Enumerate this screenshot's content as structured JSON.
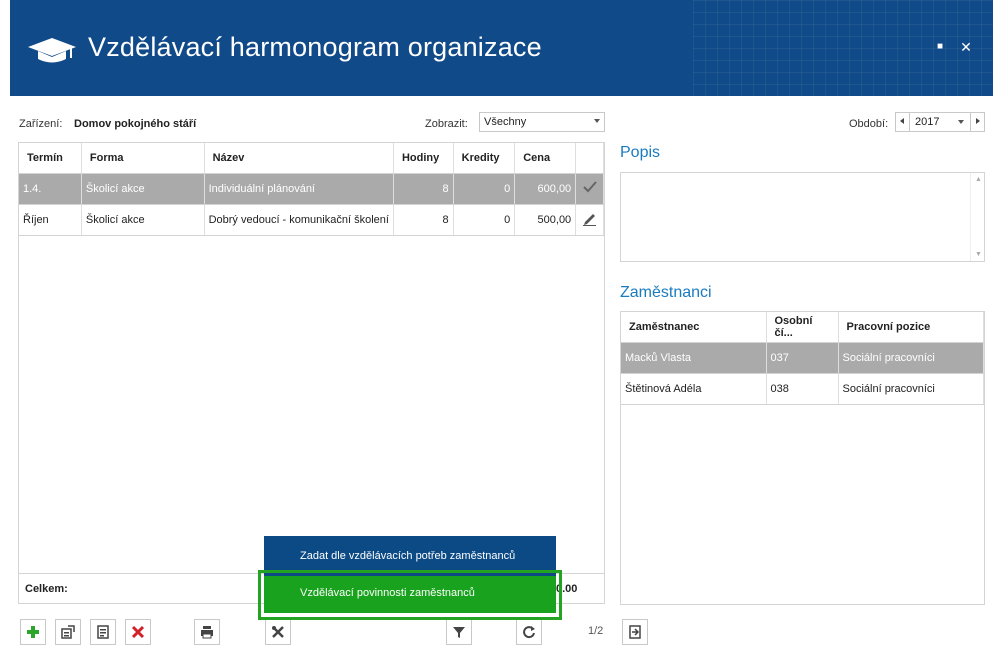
{
  "window": {
    "title": "Vzdělávací harmonogram organizace",
    "maximize_glyph": "■",
    "close_glyph": "✕"
  },
  "filters": {
    "facility_label": "Zařízení:",
    "facility_value": "Domov pokojného stáří",
    "show_label": "Zobrazit:",
    "show_value": "Všechny",
    "period_label": "Období:",
    "period_value": "2017"
  },
  "courses_table": {
    "columns": [
      "Termín",
      "Forma",
      "Název",
      "Hodiny",
      "Kredity",
      "Cena"
    ],
    "rows": [
      {
        "termin": "1.4.",
        "forma": "Školicí akce",
        "nazev": "Individuální plánování",
        "hodiny": "8",
        "kredity": "0",
        "cena": "600,00",
        "status_icon": "check-icon",
        "selected": true
      },
      {
        "termin": "Říjen",
        "forma": "Školicí akce",
        "nazev": "Dobrý vedoucí - komunikační školení",
        "hodiny": "8",
        "kredity": "0",
        "cena": "500,00",
        "status_icon": "pencil-icon",
        "selected": false
      }
    ],
    "footer_label": "Celkem:",
    "footer_total_partial": "0.00"
  },
  "description": {
    "title": "Popis"
  },
  "employees": {
    "title": "Zaměstnanci",
    "columns": [
      "Zaměstnanec",
      "Osobní čí...",
      "Pracovní pozice"
    ],
    "rows": [
      {
        "name": "Macků Vlasta",
        "id": "037",
        "position": "Sociální pracovníci",
        "selected": true
      },
      {
        "name": "Štětinová Adéla",
        "id": "038",
        "position": "Sociální pracovníci",
        "selected": false
      }
    ]
  },
  "toolbar": {
    "buttons": [
      "add-icon",
      "import-icon",
      "note-icon",
      "delete-icon",
      "print-icon",
      "tools-icon",
      "filter-icon",
      "refresh-icon"
    ],
    "page_indicator": "1/2",
    "export_icon": "export-icon"
  },
  "popup_menu": {
    "item1": "Zadat dle vzdělávacích potřeb zaměstnanců",
    "item2": "Vzdělávací povinnosti zaměstnanců"
  },
  "colors": {
    "header_bg": "#114a88",
    "accent_blue": "#1b7bbf",
    "menu_blue": "#0c4a86",
    "menu_green": "#19a21d",
    "selected_row": "#aaaaaa",
    "add_green": "#2aa62a",
    "delete_red": "#d4202a"
  }
}
